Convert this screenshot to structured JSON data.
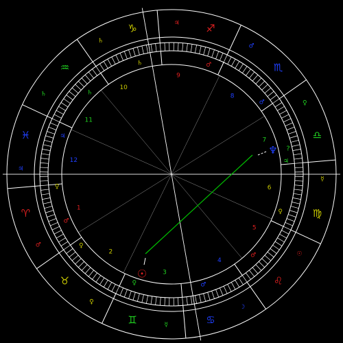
{
  "colors": {
    "background": "#000000",
    "line": "#ffffff",
    "aspect": "#00c000",
    "fire": "#e02020",
    "earth": "#c8c800",
    "air": "#20d020",
    "water": "#2040ff"
  },
  "signs": [
    {
      "name": "aries",
      "glyph": "♈",
      "ruler_glyph": "♂",
      "element": "fire"
    },
    {
      "name": "taurus",
      "glyph": "♉",
      "ruler_glyph": "♀",
      "element": "earth"
    },
    {
      "name": "gemini",
      "glyph": "♊",
      "ruler_glyph": "☿",
      "element": "air"
    },
    {
      "name": "cancer",
      "glyph": "♋",
      "ruler_glyph": "☽",
      "element": "water"
    },
    {
      "name": "leo",
      "glyph": "♌",
      "ruler_glyph": "☉",
      "element": "fire"
    },
    {
      "name": "virgo",
      "glyph": "♍",
      "ruler_glyph": "☿",
      "element": "earth"
    },
    {
      "name": "libra",
      "glyph": "♎",
      "ruler_glyph": "♀",
      "element": "air"
    },
    {
      "name": "scorpio",
      "glyph": "♏",
      "ruler_glyph": "♂",
      "element": "water"
    },
    {
      "name": "sagittarius",
      "glyph": "♐",
      "ruler_glyph": "♃",
      "element": "fire"
    },
    {
      "name": "capricorn",
      "glyph": "♑",
      "ruler_glyph": "♄",
      "element": "earth"
    },
    {
      "name": "aquarius",
      "glyph": "♒",
      "ruler_glyph": "♄",
      "element": "air"
    },
    {
      "name": "pisces",
      "glyph": "♓",
      "ruler_glyph": "♃",
      "element": "water"
    }
  ],
  "houses": [
    {
      "number": "1",
      "element": "fire"
    },
    {
      "number": "2",
      "element": "earth"
    },
    {
      "number": "3",
      "element": "air"
    },
    {
      "number": "4",
      "element": "water"
    },
    {
      "number": "5",
      "element": "fire"
    },
    {
      "number": "6",
      "element": "earth"
    },
    {
      "number": "7",
      "element": "air"
    },
    {
      "number": "8",
      "element": "water"
    },
    {
      "number": "9",
      "element": "fire"
    },
    {
      "number": "10",
      "element": "earth"
    },
    {
      "number": "11",
      "element": "air"
    },
    {
      "number": "12",
      "element": "water"
    }
  ],
  "house_rulers": [
    {
      "house": "1",
      "glyph": "♀",
      "element": "earth"
    },
    {
      "house": "1",
      "glyph": "♂",
      "element": "fire"
    },
    {
      "house": "2",
      "glyph": "♀",
      "element": "earth"
    },
    {
      "house": "3",
      "glyph": "♀",
      "element": "air"
    },
    {
      "house": "4",
      "glyph": "♂",
      "element": "water"
    },
    {
      "house": "5",
      "glyph": "♂",
      "element": "fire"
    },
    {
      "house": "6",
      "glyph": "♀",
      "element": "earth"
    },
    {
      "house": "7",
      "glyph": "♃",
      "element": "air"
    },
    {
      "house": "8",
      "glyph": "♂",
      "element": "water"
    },
    {
      "house": "9",
      "glyph": "♂",
      "element": "fire"
    },
    {
      "house": "10",
      "glyph": "♄",
      "element": "earth"
    },
    {
      "house": "11",
      "glyph": "♄",
      "element": "air"
    },
    {
      "house": "12",
      "glyph": "♃",
      "element": "water"
    }
  ],
  "planets": [
    {
      "name": "sun",
      "glyph": "☉",
      "color": "#e02020"
    },
    {
      "name": "neptune",
      "glyph": "♆",
      "color": "#2040ff"
    },
    {
      "name": "unknown-point",
      "glyph": "?",
      "color": "#20d020"
    }
  ]
}
